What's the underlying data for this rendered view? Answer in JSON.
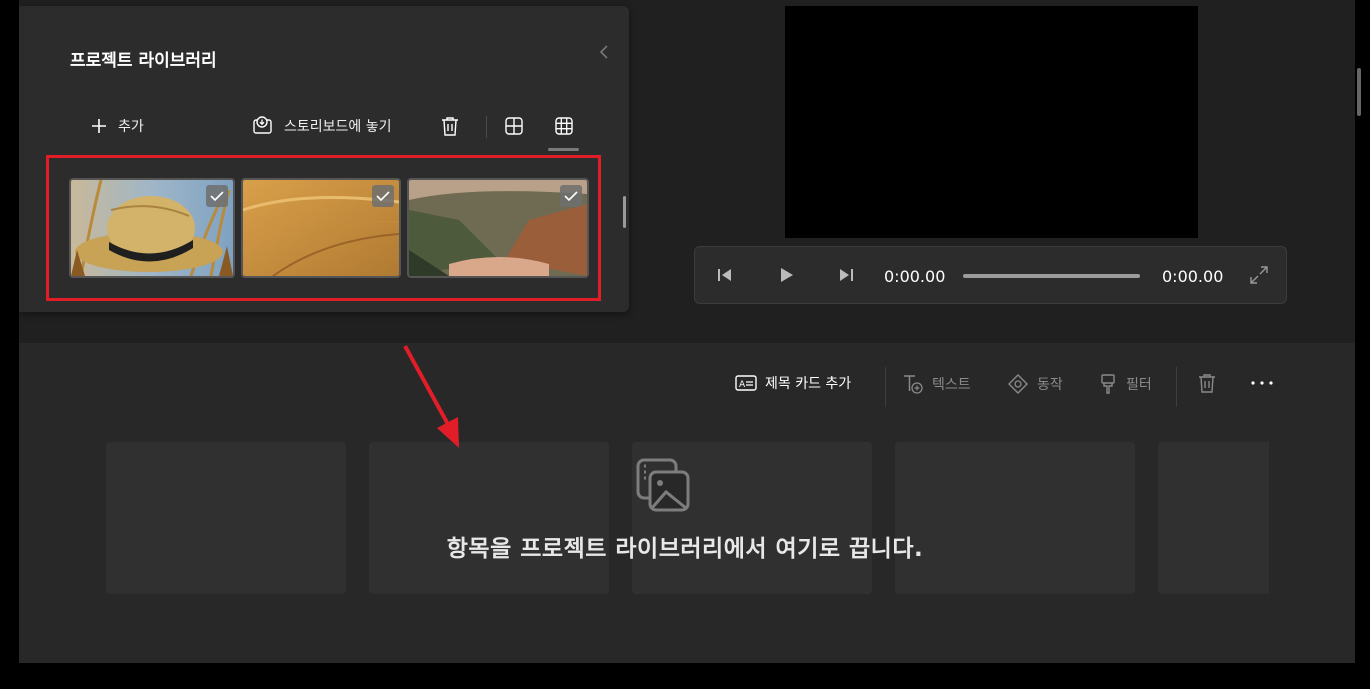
{
  "library": {
    "title": "프로젝트 라이브러리",
    "toolbar": {
      "add_label": "추가",
      "place_label": "스토리보드에 놓기"
    },
    "thumbnails": [
      {
        "name": "straw-hat-in-wheat",
        "selected": true
      },
      {
        "name": "sand-dunes",
        "selected": true
      },
      {
        "name": "mountain-valley-lake",
        "selected": true
      }
    ]
  },
  "player": {
    "current_time": "0:00.00",
    "total_time": "0:00.00",
    "progress": 0
  },
  "storyboard": {
    "toolbar": {
      "title_card_label": "제목 카드 추가",
      "text_label": "텍스트",
      "motion_label": "동작",
      "filter_label": "필터"
    },
    "drop_hint": "항목을 프로젝트 라이브러리에서 여기로 끕니다."
  },
  "colors": {
    "highlight": "#e11d28",
    "panel": "#2c2c2c",
    "background": "#202020",
    "disabled_text": "#8a8a8a"
  }
}
